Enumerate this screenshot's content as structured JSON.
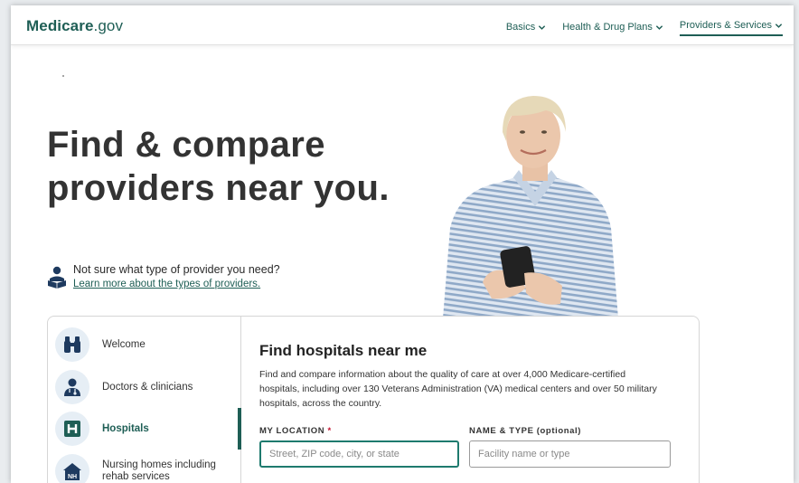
{
  "header": {
    "logo_main": "Medicare",
    "logo_suffix": ".gov",
    "nav": [
      {
        "label": "Basics",
        "active": false
      },
      {
        "label": "Health & Drug Plans",
        "active": false
      },
      {
        "label": "Providers & Services",
        "active": true
      }
    ]
  },
  "hero": {
    "title_line1": "Find & compare",
    "title_line2": "providers near you.",
    "help_question": "Not sure what type of provider you need?",
    "help_link": "Learn more about the types of providers."
  },
  "sidebar": {
    "items": [
      {
        "label": "Welcome",
        "icon": "binoculars-icon"
      },
      {
        "label": "Doctors & clinicians",
        "icon": "doctor-icon"
      },
      {
        "label": "Hospitals",
        "icon": "hospital-icon",
        "active": true
      },
      {
        "label": "Nursing homes including rehab services",
        "icon": "nursing-home-icon"
      }
    ]
  },
  "main": {
    "title": "Find hospitals near me",
    "description": "Find and compare information about the quality of care at over 4,000 Medicare-certified hospitals, including over 130 Veterans Administration (VA) medical centers and over 50 military hospitals, across the country.",
    "location_label": "MY LOCATION",
    "location_required": "*",
    "location_placeholder": "Street, ZIP code, city, or state",
    "name_label": "NAME & TYPE (optional)",
    "name_placeholder": "Facility name or type"
  },
  "colors": {
    "brand": "#1e5e55",
    "required": "#c4122f",
    "icon_bg": "#e6eef5"
  }
}
